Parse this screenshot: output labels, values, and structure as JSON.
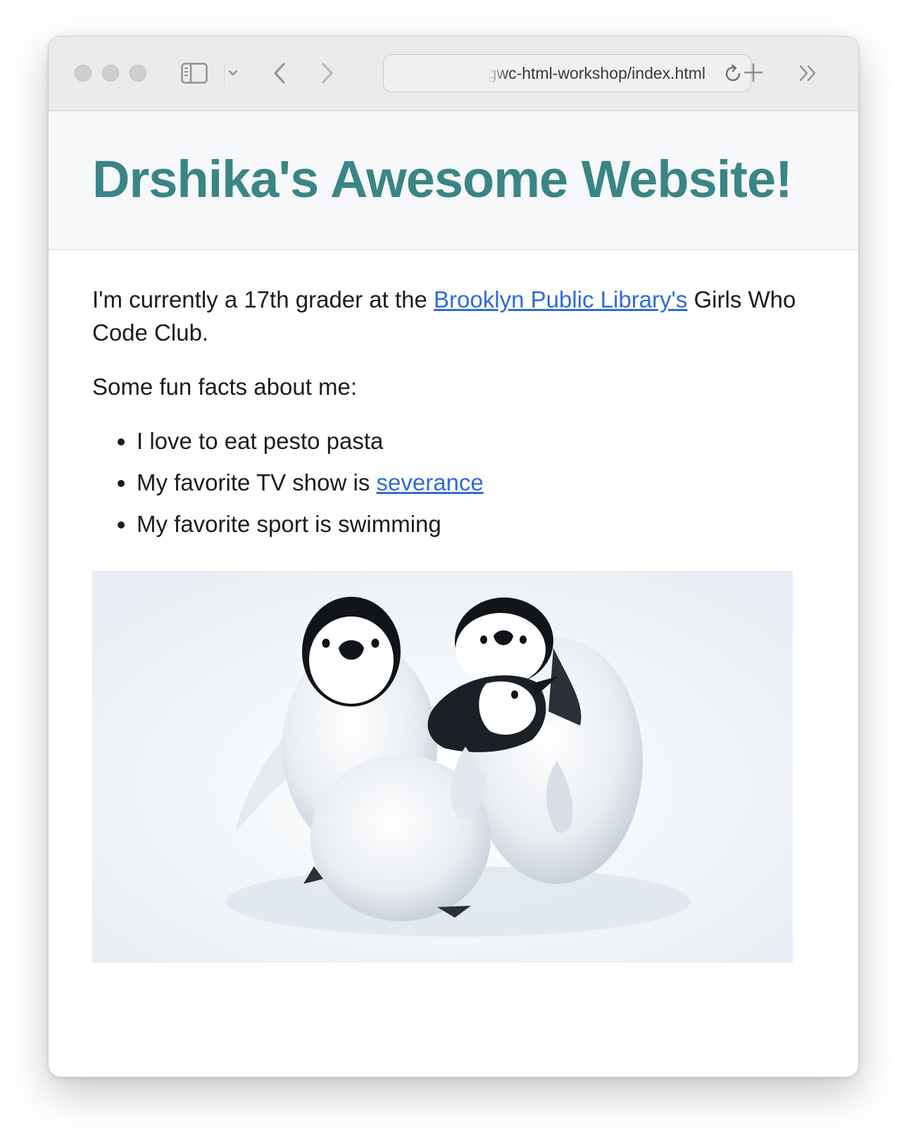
{
  "browser": {
    "url": "gwc-html-workshop/index.html",
    "colors": {
      "toolbar": "#ebebed",
      "icon": "#8e8e93"
    },
    "icons": [
      "sidebar-toggle-icon",
      "chevron-down-icon",
      "back-arrow-icon",
      "forward-arrow-icon",
      "reload-icon",
      "plus-icon",
      "double-chevron-right-icon"
    ]
  },
  "page": {
    "title": "Drshika's Awesome Website!",
    "intro": {
      "before": "I'm currently a 17th grader at the ",
      "link": "Brooklyn Public Library's",
      "after": " Girls Who Code Club."
    },
    "facts_heading": "Some fun facts about me:",
    "facts": [
      {
        "text": "I love to eat pesto pasta"
      },
      {
        "text": "My favorite TV show is ",
        "link": "severance"
      },
      {
        "text": "My favorite sport is swimming"
      }
    ],
    "colors": {
      "title": "#3a8585",
      "link": "#2f6bd8",
      "header_bg": "#f6f8fa"
    }
  }
}
